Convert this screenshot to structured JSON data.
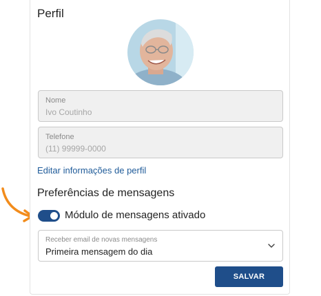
{
  "profile": {
    "title": "Perfil",
    "name_label": "Nome",
    "name_value": "Ivo Coutinho",
    "phone_label": "Telefone",
    "phone_placeholder": "(11) 99999-0000",
    "edit_link": "Editar informações de perfil"
  },
  "messages": {
    "section_title": "Preferências de mensagens",
    "toggle_label": "Módulo de mensagens ativado",
    "toggle_on": true,
    "email_select_label": "Receber email de novas mensagens",
    "email_select_value": "Primeira mensagem do dia"
  },
  "actions": {
    "save_label": "SALVAR"
  },
  "colors": {
    "accent": "#1f4e8a",
    "link": "#1f5b99",
    "annotation_arrow": "#f28c1c"
  },
  "icons": {
    "select_chevron": "chevron-down-icon",
    "annotation": "orange-arrow-icon"
  }
}
